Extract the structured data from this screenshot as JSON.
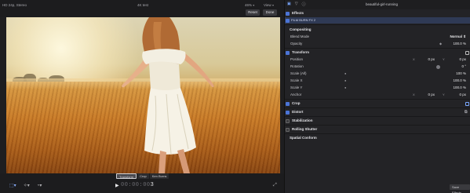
{
  "viewer": {
    "resolution": "HD 24p, Stereo",
    "center_label": "4K test",
    "zoom": "46%",
    "view_label": "View",
    "reset_label": "Reset",
    "done_label": "Done",
    "transform_buttons": [
      "Transform",
      "Crop",
      "Ken Burns"
    ],
    "timecode_dim": "00:00:00",
    "timecode_lit": "3"
  },
  "inspector": {
    "clip_title": "beautiful-girl-running",
    "effects_header": "Effects",
    "effect_name": "FILM BURN FX 2",
    "compositing": "Compositing",
    "blend_mode_label": "Blend Mode",
    "blend_mode_value": "Normal",
    "opacity_label": "Opacity",
    "opacity_value": "100.0 %",
    "transform_header": "Transform",
    "position_label": "Position",
    "position_x_key": "X",
    "position_x": "0 px",
    "position_y_key": "Y",
    "position_y": "0 px",
    "rotation_label": "Rotation",
    "rotation_value": "0 °",
    "scale_all_label": "Scale (All)",
    "scale_all_value": "100 %",
    "scale_x_label": "Scale X",
    "scale_x_value": "100.0 %",
    "scale_y_label": "Scale Y",
    "scale_y_value": "100.0 %",
    "anchor_label": "Anchor",
    "anchor_x_key": "X",
    "anchor_x": "0 px",
    "anchor_y_key": "Y",
    "anchor_y": "0 px",
    "crop_header": "Crop",
    "distort_header": "Distort",
    "stabilization_header": "Stabilization",
    "rolling_shutter_header": "Rolling Shutter",
    "spatial_conform_header": "Spatial Conform",
    "save_effects_label": "Save Effects"
  },
  "colors": {
    "accent": "#4b74d6",
    "selected_row": "#2f3a55"
  }
}
